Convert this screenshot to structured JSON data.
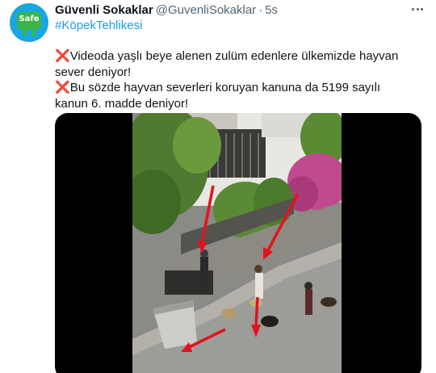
{
  "author": {
    "display_name": "Güvenli Sokaklar",
    "handle": "@GuvenliSokaklar",
    "separator": "·",
    "time": "5s",
    "avatar_text": "Safe"
  },
  "tweet": {
    "hashtag": "#KöpekTehlikesi",
    "line1_mark": "❌",
    "line1_text": "Videoda yaşlı beye alenen zulüm edenlere ülkemizde hayvan sever deniyor!",
    "line2_mark": "❌",
    "line2_text": "Bu sözde hayvan severleri koruyan kanuna da 5199 sayılı kanun 6. madde deniyor!"
  },
  "colors": {
    "link": "#1d9bf0",
    "secondary_text": "#536471",
    "arrow": "#e0141e",
    "avatar_bg": "#1aa6e0",
    "avatar_badge": "#3bb54a"
  },
  "icons": {
    "more": "more-horizontal-icon",
    "mark": "cross-mark-icon"
  }
}
